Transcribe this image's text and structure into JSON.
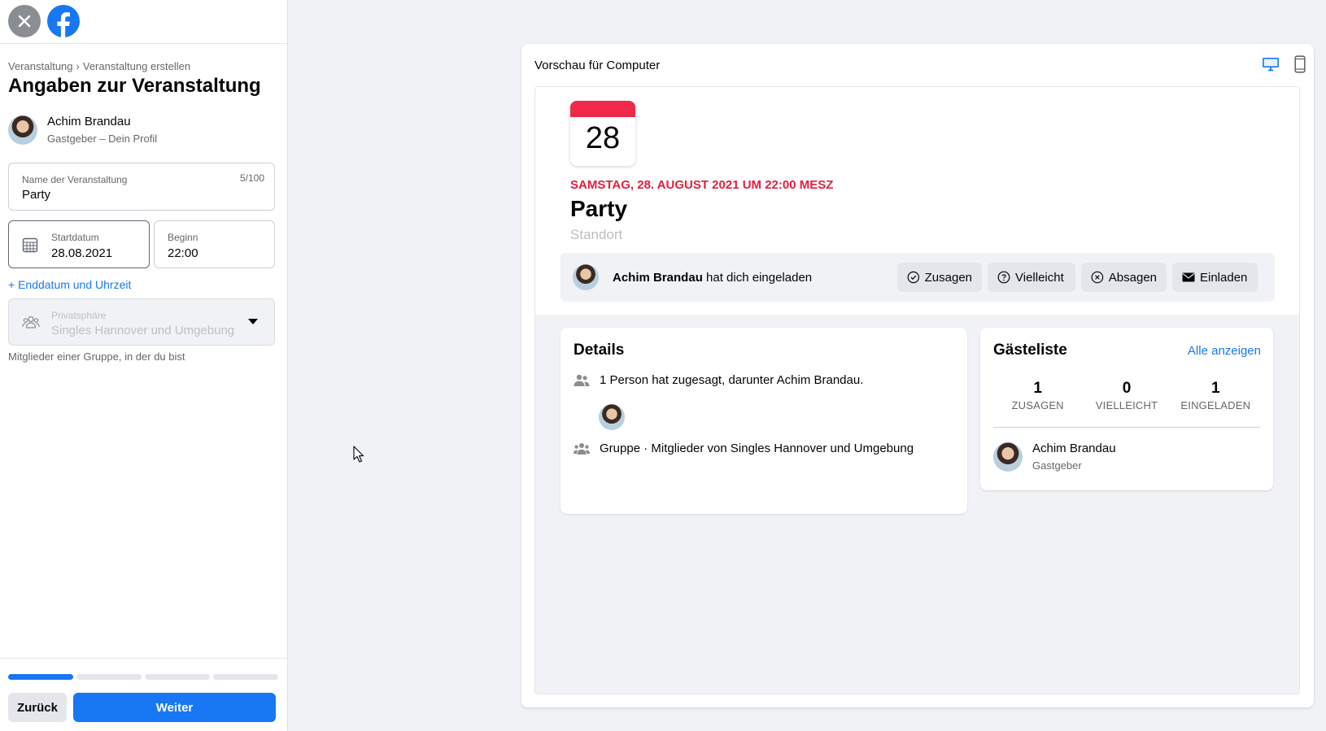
{
  "breadcrumb": {
    "item1": "Veranstaltung",
    "separator": "›",
    "item2": "Veranstaltung erstellen"
  },
  "form": {
    "title": "Angaben zur Veranstaltung",
    "host_name": "Achim Brandau",
    "host_sub": "Gastgeber – Dein Profil",
    "name_label": "Name der Veranstaltung",
    "name_value": "Party",
    "name_count": "5/100",
    "start_label": "Startdatum",
    "start_value": "28.08.2021",
    "begin_label": "Beginn",
    "begin_value": "22:00",
    "add_end_link": "+ Enddatum und Uhrzeit",
    "privacy_label": "Privatsphäre",
    "privacy_value": "Singles Hannover und Umgebung",
    "privacy_help": "Mitglieder einer Gruppe, in der du bist"
  },
  "footer": {
    "back_label": "Zurück",
    "next_label": "Weiter",
    "progress_steps": 4,
    "progress_current": 1
  },
  "preview": {
    "title": "Vorschau für Computer",
    "calendar_day": "28",
    "date_line": "SAMSTAG, 28. AUGUST 2021 UM 22:00 MESZ",
    "event_name": "Party",
    "location": "Standort",
    "inviter": "Achim Brandau",
    "invite_suffix": "hat dich eingeladen",
    "rsvp": {
      "going": "Zusagen",
      "maybe": "Vielleicht",
      "decline": "Absagen",
      "invite": "Einladen"
    },
    "details": {
      "title": "Details",
      "going_text": "1 Person hat zugesagt, darunter Achim Brandau.",
      "group_text": "Gruppe · Mitglieder von Singles Hannover und Umgebung"
    },
    "guests": {
      "title": "Gästeliste",
      "see_all": "Alle anzeigen",
      "going_count": "1",
      "going_label": "ZUSAGEN",
      "maybe_count": "0",
      "maybe_label": "VIELLEICHT",
      "invited_count": "1",
      "invited_label": "EINGELADEN",
      "host_name": "Achim Brandau",
      "host_role": "Gastgeber"
    }
  },
  "colors": {
    "accent": "#1877f2",
    "date_red": "#e41e3f",
    "calendar_bar": "#f02849"
  },
  "icons": [
    "close-icon",
    "facebook-logo-icon",
    "calendar-icon",
    "group-icon",
    "chevron-down-icon",
    "desktop-icon",
    "mobile-icon",
    "check-circle-icon",
    "question-circle-icon",
    "x-circle-icon",
    "envelope-icon",
    "people-icon",
    "cursor-icon"
  ]
}
